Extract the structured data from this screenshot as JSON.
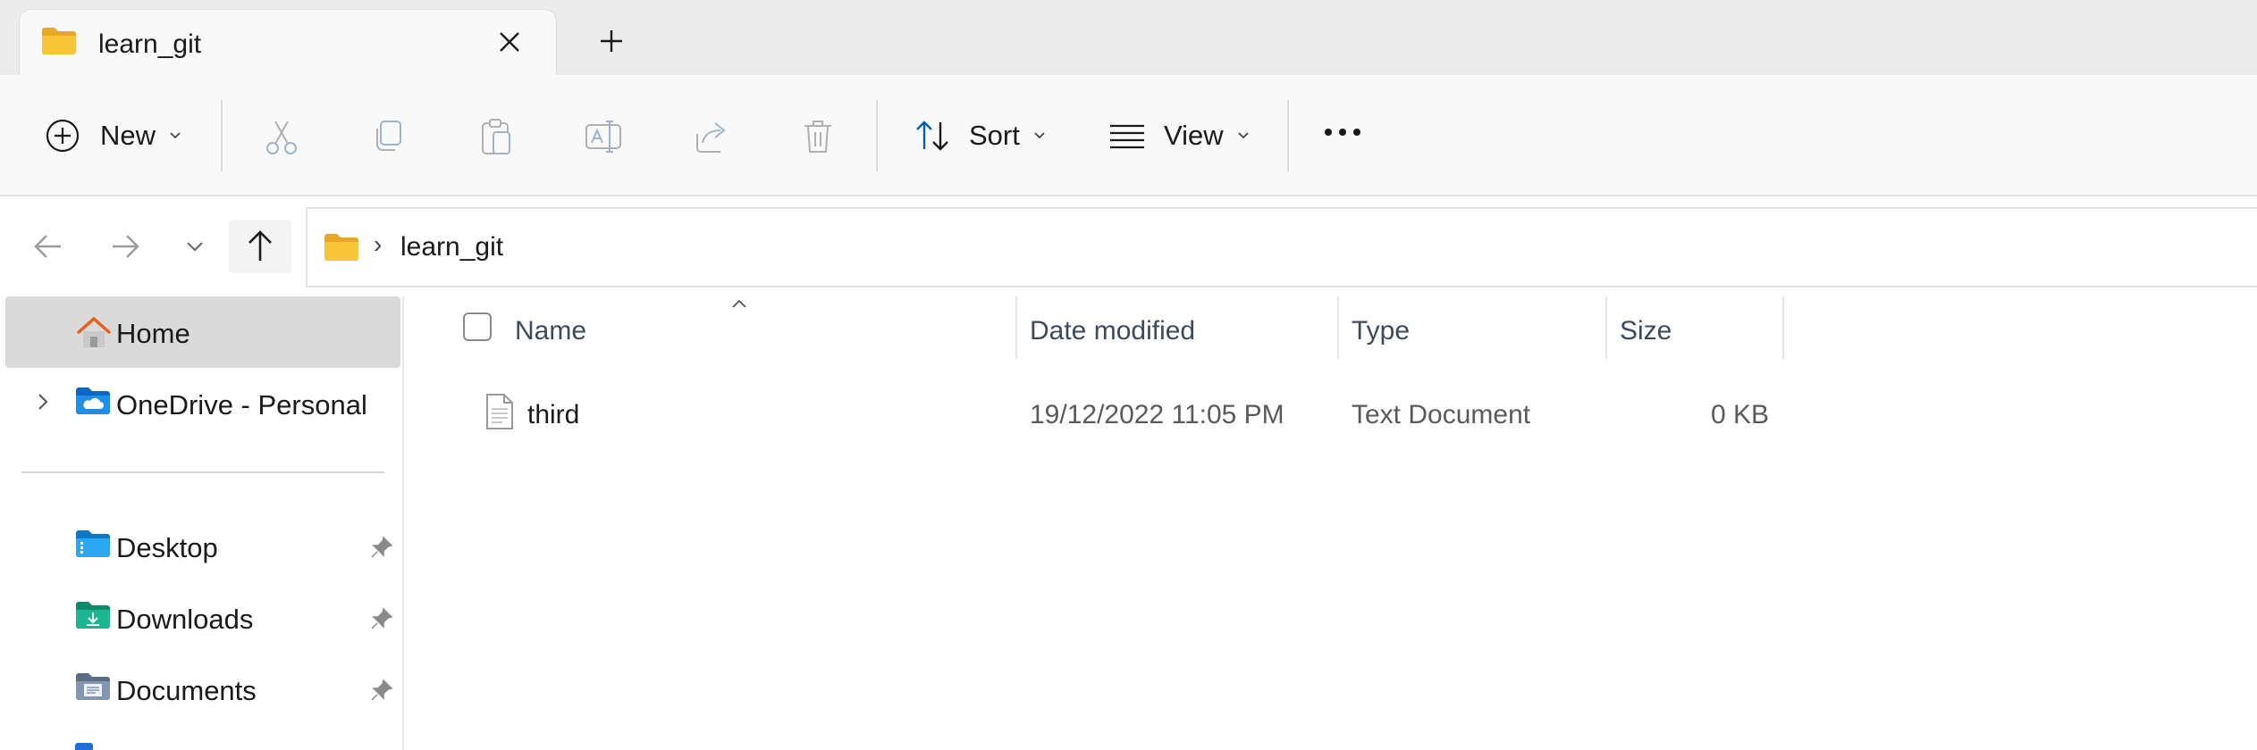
{
  "tab": {
    "title": "learn_git",
    "folder_icon": "folder-icon",
    "close_icon": "close-icon",
    "new_tab_icon": "plus-icon"
  },
  "toolbar": {
    "new_label": "New",
    "sort_label": "Sort",
    "view_label": "View",
    "icons": [
      "cut-icon",
      "copy-icon",
      "paste-icon",
      "rename-icon",
      "share-icon",
      "delete-icon",
      "more-icon"
    ]
  },
  "address": {
    "path": [
      "learn_git"
    ]
  },
  "sidebar": {
    "items": [
      {
        "label": "Home",
        "icon": "home-icon"
      },
      {
        "label": "OneDrive - Personal",
        "icon": "onedrive-folder-icon"
      },
      {
        "label": "Desktop",
        "icon": "desktop-folder-icon",
        "pinned": true
      },
      {
        "label": "Downloads",
        "icon": "downloads-folder-icon",
        "pinned": true
      },
      {
        "label": "Documents",
        "icon": "documents-folder-icon",
        "pinned": true
      }
    ]
  },
  "filelist": {
    "columns": [
      "Name",
      "Date modified",
      "Type",
      "Size"
    ],
    "rows": [
      {
        "name": "third",
        "date_modified": "19/12/2022 11:05 PM",
        "type": "Text Document",
        "size": "0 KB",
        "icon": "text-document-icon"
      }
    ]
  },
  "colors": {
    "accent": "#005fb8",
    "folder": "#f8c53a",
    "home": "#e8601c"
  }
}
